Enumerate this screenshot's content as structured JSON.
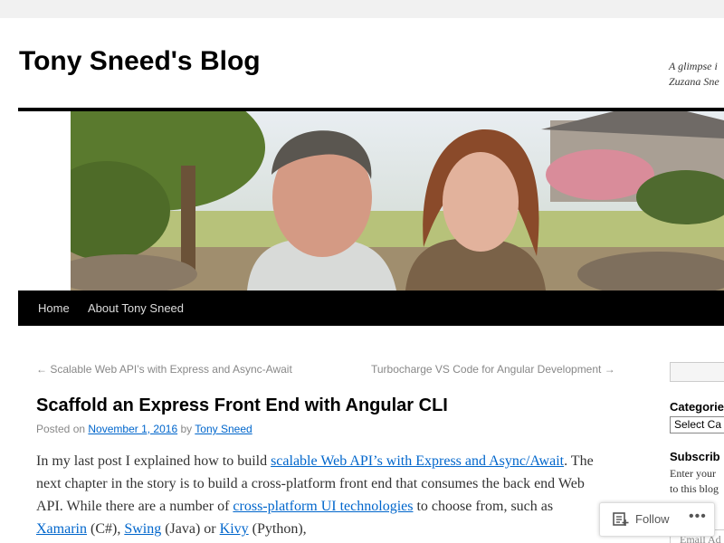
{
  "site": {
    "title": "Tony Sneed's Blog",
    "description_line1": "A glimpse i",
    "description_line2": "Zuzana Sne"
  },
  "nav": {
    "items": [
      "Home",
      "About Tony Sneed"
    ]
  },
  "post_nav": {
    "previous": "← Scalable Web API’s with Express and Async-Await",
    "next": "Turbocharge VS Code for Angular Development →"
  },
  "post": {
    "title": "Scaffold an Express Front End with Angular CLI",
    "posted_on": "Posted on",
    "date": "November 1, 2016",
    "by": "by",
    "author": "Tony Sneed",
    "body": {
      "t1": "In my last post I explained how to build ",
      "l1": "scalable Web API’s with Express and Async/Await",
      "t2": ".  The next chapter in the story is to build a cross-platform front end that consumes the back end Web API.  While there are a number of ",
      "l2": "cross-platform UI technologies",
      "t3": " to choose from, such as ",
      "l3": "Xamarin",
      "t4": " (C#), ",
      "l4": "Swing",
      "t5": " (Java) or ",
      "l5": "Kivy",
      "t6": " (Python),"
    }
  },
  "sidebar": {
    "categories_heading": "Categorie",
    "categories_select": "Select Ca",
    "subscribe_heading": "Subscrib",
    "subscribe_line1": "Enter your",
    "subscribe_line2": "to this blog",
    "email_placeholder": "Email Ad"
  },
  "follow": {
    "label": "Follow",
    "more": "•••",
    "icon": "follow-icon"
  },
  "colors": {
    "link": "#0066cc",
    "nav_bg": "#000000",
    "page_bg": "#f1f1f1"
  }
}
